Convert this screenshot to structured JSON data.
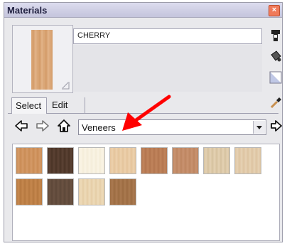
{
  "window": {
    "title": "Materials",
    "close_glyph": "×"
  },
  "material": {
    "name": "CHERRY"
  },
  "tabs": [
    {
      "label": "Select"
    },
    {
      "label": "Edit"
    }
  ],
  "library": {
    "selected": "Veneers"
  },
  "icons": {
    "side": [
      "create-material-icon",
      "paint-bucket-icon",
      "sample-material-icon"
    ],
    "eyedropper": "eyedropper-icon",
    "back": "back-arrow-icon",
    "forward": "forward-arrow-icon",
    "home": "home-icon",
    "details": "details-arrow-icon"
  },
  "colors": {
    "annotation_arrow": "#ff0000",
    "accent_window": "#c8c8e0"
  },
  "swatches": [
    {
      "name": "veneer-1",
      "colors": [
        "#c98b55",
        "#d59b68"
      ]
    },
    {
      "name": "veneer-2",
      "colors": [
        "#4a3326",
        "#5c4334"
      ]
    },
    {
      "name": "veneer-3",
      "colors": [
        "#f4edd9",
        "#faf4e5"
      ]
    },
    {
      "name": "veneer-4",
      "colors": [
        "#e4c49b",
        "#edd1ad"
      ]
    },
    {
      "name": "veneer-5",
      "colors": [
        "#b3764f",
        "#c0845c"
      ]
    },
    {
      "name": "veneer-6",
      "colors": [
        "#bd8560",
        "#c99370"
      ]
    },
    {
      "name": "veneer-7",
      "colors": [
        "#d6c19f",
        "#e4d2b3"
      ]
    },
    {
      "name": "veneer-8",
      "colors": [
        "#dcc3a1",
        "#e7d2b4"
      ]
    },
    {
      "name": "veneer-9",
      "colors": [
        "#b5783f",
        "#c6884f"
      ]
    },
    {
      "name": "veneer-10",
      "colors": [
        "#5d4738",
        "#6b5343"
      ]
    },
    {
      "name": "veneer-11",
      "colors": [
        "#e5cda6",
        "#eedbb9"
      ]
    },
    {
      "name": "veneer-12",
      "colors": [
        "#9b6b42",
        "#ab7a50"
      ]
    }
  ]
}
